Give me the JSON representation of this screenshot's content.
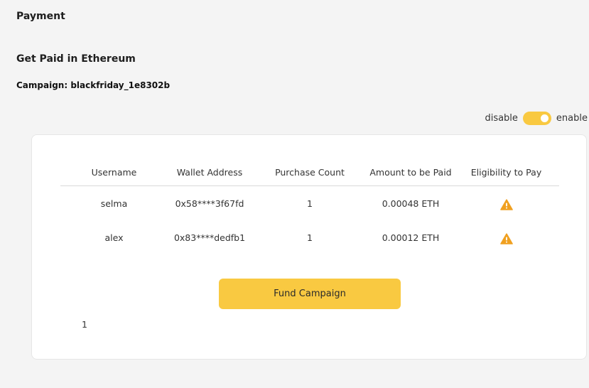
{
  "page": {
    "title": "Payment"
  },
  "section": {
    "title": "Get Paid in Ethereum",
    "campaign_label": "Campaign: blackfriday_1e8302b"
  },
  "toggle": {
    "off_label": "disable",
    "on_label": "enable",
    "state": "enabled",
    "color": "#f9c941"
  },
  "table": {
    "headers": [
      "Username",
      "Wallet Address",
      "Purchase Count",
      "Amount to be Paid",
      "Eligibility to Pay"
    ],
    "rows": [
      {
        "username": "selma",
        "wallet": "0x58****3f67fd",
        "count": "1",
        "amount": "0.00048 ETH",
        "eligibility_icon": "warning-icon"
      },
      {
        "username": "alex",
        "wallet": "0x83****dedfb1",
        "count": "1",
        "amount": "0.00012 ETH",
        "eligibility_icon": "warning-icon"
      }
    ]
  },
  "fund_button": {
    "label": "Fund Campaign"
  },
  "pagination": {
    "current": "1"
  },
  "colors": {
    "accent": "#f9c941",
    "warning": "#f0a020"
  }
}
